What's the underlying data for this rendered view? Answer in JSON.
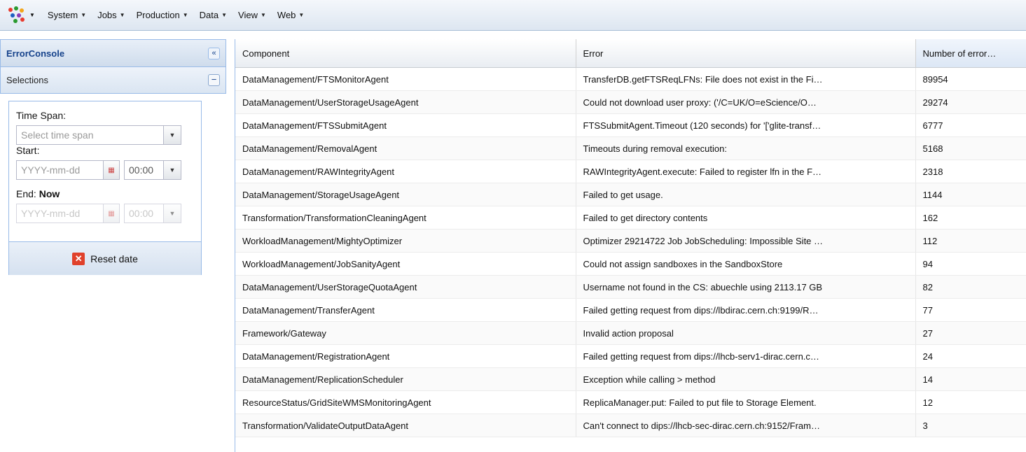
{
  "menubar": {
    "items": [
      {
        "label": "System"
      },
      {
        "label": "Jobs"
      },
      {
        "label": "Production"
      },
      {
        "label": "Data"
      },
      {
        "label": "View"
      },
      {
        "label": "Web"
      }
    ]
  },
  "left_panel": {
    "title": "ErrorConsole",
    "selections_title": "Selections",
    "time_span_label": "Time Span:",
    "time_span_placeholder": "Select time span",
    "start_label": "Start:",
    "start_date_placeholder": "YYYY-mm-dd",
    "start_time_value": "00:00",
    "end_label": "End:",
    "end_value_bold": "Now",
    "end_date_placeholder": "YYYY-mm-dd",
    "end_time_value": "00:00",
    "reset_label": "Reset date"
  },
  "grid": {
    "headers": [
      "Component",
      "Error",
      "Number of error…"
    ],
    "rows": [
      [
        "DataManagement/FTSMonitorAgent",
        "TransferDB.getFTSReqLFNs: File does not exist in the Fi…",
        "89954"
      ],
      [
        "DataManagement/UserStorageUsageAgent",
        "Could not download user proxy: ('/C=UK/O=eScience/O…",
        "29274"
      ],
      [
        "DataManagement/FTSSubmitAgent",
        "FTSSubmitAgent.Timeout (120 seconds) for '['glite-transf…",
        "6777"
      ],
      [
        "DataManagement/RemovalAgent",
        "Timeouts during removal execution:",
        "5168"
      ],
      [
        "DataManagement/RAWIntegrityAgent",
        "RAWIntegrityAgent.execute: Failed to register lfn in the F…",
        "2318"
      ],
      [
        "DataManagement/StorageUsageAgent",
        "Failed to get usage.",
        "1144"
      ],
      [
        "Transformation/TransformationCleaningAgent",
        "Failed to get directory contents",
        "162"
      ],
      [
        "WorkloadManagement/MightyOptimizer",
        "Optimizer 29214722 Job JobScheduling: Impossible Site …",
        "112"
      ],
      [
        "WorkloadManagement/JobSanityAgent",
        "Could not assign sandboxes in the SandboxStore",
        "94"
      ],
      [
        "DataManagement/UserStorageQuotaAgent",
        "Username not found in the CS: abuechle using 2113.17 GB",
        "82"
      ],
      [
        "DataManagement/TransferAgent",
        "Failed getting request from dips://lbdirac.cern.ch:9199/R…",
        "77"
      ],
      [
        "Framework/Gateway",
        "Invalid action proposal",
        "27"
      ],
      [
        "DataManagement/RegistrationAgent",
        "Failed getting request from dips://lhcb-serv1-dirac.cern.c…",
        "24"
      ],
      [
        "DataManagement/ReplicationScheduler",
        "Exception while calling > method",
        "14"
      ],
      [
        "ResourceStatus/GridSiteWMSMonitoringAgent",
        "ReplicaManager.put: Failed to put file to Storage Element.",
        "12"
      ],
      [
        "Transformation/ValidateOutputDataAgent",
        "Can't connect to dips://lhcb-sec-dirac.cern.ch:9152/Fram…",
        "3"
      ]
    ]
  },
  "icons": {
    "logo": "app-logo-icon",
    "collapse": "double-chevron-left-icon",
    "minus": "minus-icon",
    "combo": "chevron-down-icon",
    "calendar": "calendar-icon",
    "reset": "close-x-icon"
  }
}
